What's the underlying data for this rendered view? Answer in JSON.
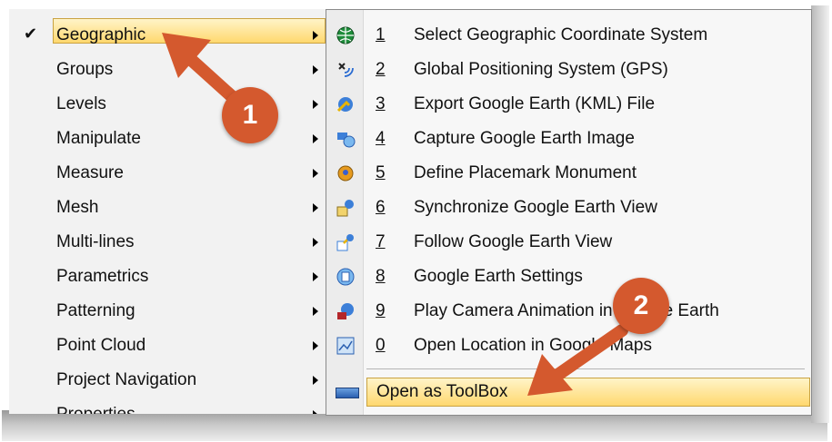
{
  "left_menu": {
    "items": [
      {
        "label": "Geographic",
        "checked": true,
        "highlighted": true
      },
      {
        "label": "Groups"
      },
      {
        "label": "Levels"
      },
      {
        "label": "Manipulate"
      },
      {
        "label": "Measure"
      },
      {
        "label": "Mesh"
      },
      {
        "label": "Multi-lines"
      },
      {
        "label": "Parametrics"
      },
      {
        "label": "Patterning"
      },
      {
        "label": "Point Cloud"
      },
      {
        "label": "Project Navigation"
      },
      {
        "label": "Properties"
      }
    ],
    "check_glyph": "✔"
  },
  "submenu": {
    "items": [
      {
        "num": "1",
        "label": "Select Geographic Coordinate System",
        "icon": "globe-icon"
      },
      {
        "num": "2",
        "label": "Global Positioning System (GPS)",
        "icon": "gps-icon"
      },
      {
        "num": "3",
        "label": "Export Google Earth (KML) File",
        "icon": "export-kml-icon"
      },
      {
        "num": "4",
        "label": "Capture Google Earth Image",
        "icon": "capture-image-icon"
      },
      {
        "num": "5",
        "label": "Define Placemark Monument",
        "icon": "placemark-icon"
      },
      {
        "num": "6",
        "label": "Synchronize Google Earth View",
        "icon": "synchronize-icon"
      },
      {
        "num": "7",
        "label": "Follow Google Earth View",
        "icon": "follow-view-icon"
      },
      {
        "num": "8",
        "label": "Google Earth Settings",
        "icon": "settings-icon"
      },
      {
        "num": "9",
        "label": "Play Camera Animation in Google Earth",
        "icon": "camera-animation-icon"
      },
      {
        "num": "0",
        "label": "Open Location in Google Maps",
        "icon": "map-icon"
      }
    ],
    "toolbox_label": "Open as ToolBox"
  },
  "annotations": {
    "badge_1": "1",
    "badge_2": "2",
    "color": "#d4592e"
  },
  "colors": {
    "highlight": "#ffd86e",
    "highlight_border": "#c9a240"
  }
}
